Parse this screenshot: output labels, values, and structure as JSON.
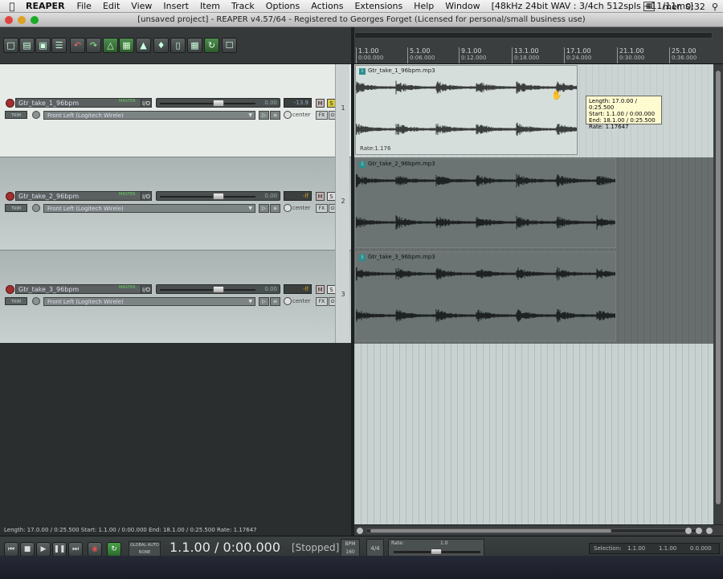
{
  "menubar": {
    "app": "REAPER",
    "items": [
      "File",
      "Edit",
      "View",
      "Insert",
      "Item",
      "Track",
      "Options",
      "Actions",
      "Extensions",
      "Help",
      "Window",
      "[48kHz 24bit WAV : 3/4ch 512spls ~11/11ms]"
    ],
    "clock": "mer. 0:32"
  },
  "window": {
    "title": "[unsaved project] - REAPER v4.57/64 - Registered to Georges Forget (Licensed for personal/small business use)"
  },
  "toolbar": {
    "icons": [
      "new-project-icon",
      "open-project-icon",
      "save-project-icon",
      "project-settings-icon",
      "undo-icon",
      "redo-icon",
      "metronome-icon",
      "snap-icon",
      "ripple-edit-icon",
      "envelope-lock-icon",
      "grid-icon",
      "item-grouping-icon",
      "loop-icon",
      "lock-icon"
    ]
  },
  "ruler": {
    "marks": [
      {
        "bar": "1.1.00",
        "time": "0:00.000"
      },
      {
        "bar": "5.1.00",
        "time": "0:06.000"
      },
      {
        "bar": "9.1.00",
        "time": "0:12.000"
      },
      {
        "bar": "13.1.00",
        "time": "0:18.000"
      },
      {
        "bar": "17.1.00",
        "time": "0:24.000"
      },
      {
        "bar": "21.1.00",
        "time": "0:30.000"
      },
      {
        "bar": "25.1.00",
        "time": "0:36.000"
      }
    ]
  },
  "tracks": [
    {
      "num": "1",
      "name": "Gtr_take_1_96bpm",
      "meter_label": "MASTER",
      "io": "I/O",
      "volume": "0.00",
      "peak": "-13.9",
      "mute": "M",
      "solo": "S",
      "trim": "TRIM",
      "route": "Front Left (Logitech Wirele)",
      "pan": "center",
      "fx": "FX",
      "item": "Gtr_take_1_96bpm.mp3",
      "rate_label": "Rate:1.176"
    },
    {
      "num": "2",
      "name": "Gtr_take_2_96bpm",
      "meter_label": "MASTER",
      "io": "I/O",
      "volume": "0.00",
      "peak": "-lf",
      "mute": "M",
      "solo": "S",
      "trim": "TRIM",
      "route": "Front Left (Logitech Wirele)",
      "pan": "center",
      "fx": "FX",
      "item": "Gtr_take_2_96bpm.mp3",
      "rate_label": ""
    },
    {
      "num": "3",
      "name": "Gtr_take_3_96bpm",
      "meter_label": "MASTER",
      "io": "I/O",
      "volume": "0.00",
      "peak": "-lf",
      "mute": "M",
      "solo": "S",
      "trim": "TRIM",
      "route": "Front Left (Logitech Wirele)",
      "pan": "center",
      "fx": "FX",
      "item": "Gtr_take_3_96bpm.mp3",
      "rate_label": ""
    }
  ],
  "tooltip": {
    "lines": [
      "Length: 17.0.00 / 0:25.500",
      "Start: 1.1.00 / 0:00.000",
      "End: 18.1.00 / 0:25.500",
      "Rate: 1.17647"
    ]
  },
  "status": {
    "text": "Length: 17.0.00 / 0:25.500 Start: 1.1.00 / 0:00.000 End: 18.1.00 / 0:25.500 Rate: 1.17647"
  },
  "transport": {
    "global_auto": "GLOBAL AUTO",
    "auto_mode": "NONE",
    "position": "1.1.00 / 0:00.000",
    "state": "[Stopped]",
    "bpm_label": "BPM",
    "bpm": "160",
    "time_sig": "4/4",
    "rate_label": "Rate:",
    "rate": "1.0",
    "selection_label": "Selection:",
    "sel_start": "1.1.00",
    "sel_end": "1.1.00",
    "sel_length": "0.0.000"
  },
  "colors": {
    "item_icon": "#2c8f8f",
    "solo_on": "#d8cc3c",
    "record_arm": "#a03030"
  }
}
